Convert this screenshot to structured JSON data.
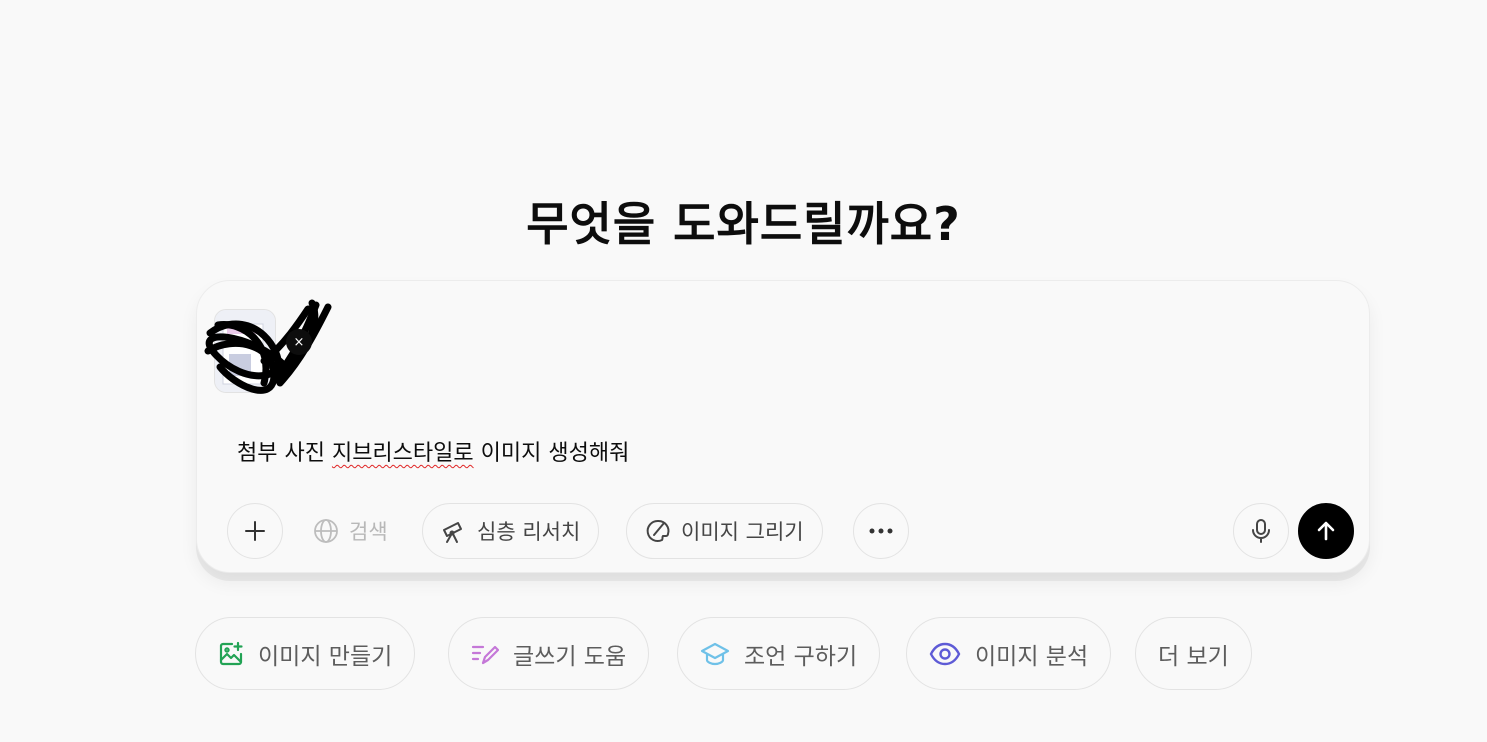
{
  "heading": "무엇을 도와드릴까요?",
  "composer": {
    "attachment": {
      "remove_glyph": "×",
      "icon": "image-thumbnail"
    },
    "prompt_text_before": "첨부 사진 ",
    "prompt_text_misspelled": "지브리스타일로",
    "prompt_text_after": " 이미지 생성해줘",
    "toolbar": {
      "add_label": "",
      "search_label": "검색",
      "deep_research_label": "심층 리서치",
      "draw_image_label": "이미지 그리기",
      "more_label": "",
      "voice_label": "",
      "send_label": ""
    }
  },
  "suggestions": [
    {
      "label": "이미지 만들기",
      "icon": "image-create-icon",
      "color": "#22a355"
    },
    {
      "label": "글쓰기 도움",
      "icon": "pen-icon",
      "color": "#c578d8"
    },
    {
      "label": "조언 구하기",
      "icon": "graduation-cap-icon",
      "color": "#6fc1e8"
    },
    {
      "label": "이미지 분석",
      "icon": "eye-icon",
      "color": "#5e5bd6"
    },
    {
      "label": "더 보기",
      "icon": "",
      "color": ""
    }
  ],
  "colors": {
    "background": "#f9f9f9",
    "send_button": "#000000",
    "spell_underline": "#e02424"
  }
}
